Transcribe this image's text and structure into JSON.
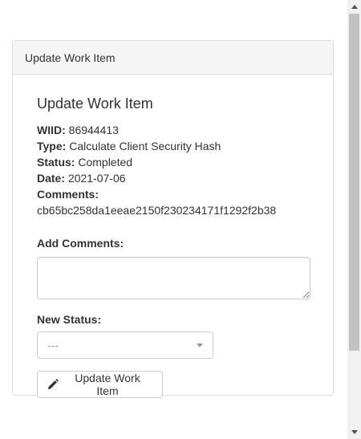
{
  "panel": {
    "heading": "Update Work Item"
  },
  "form": {
    "title": "Update Work Item",
    "wiid_label": "WIID:",
    "wiid_value": "86944413",
    "type_label": "Type:",
    "type_value": "Calculate Client Security Hash",
    "status_label": "Status:",
    "status_value": "Completed",
    "date_label": "Date:",
    "date_value": "2021-07-06",
    "comments_label": "Comments:",
    "comments_value": "cb65bc258da1eeae2150f230234171f1292f2b38",
    "add_comments_label": "Add Comments:",
    "add_comments_value": "",
    "new_status_label": "New Status:",
    "new_status_selected": "---",
    "submit_label": "Update Work Item",
    "submit_icon": "pencil-icon"
  },
  "colors": {
    "panel_heading_bg": "#f5f5f5",
    "border": "#dddddd",
    "text": "#333333",
    "placeholder": "#999999"
  }
}
